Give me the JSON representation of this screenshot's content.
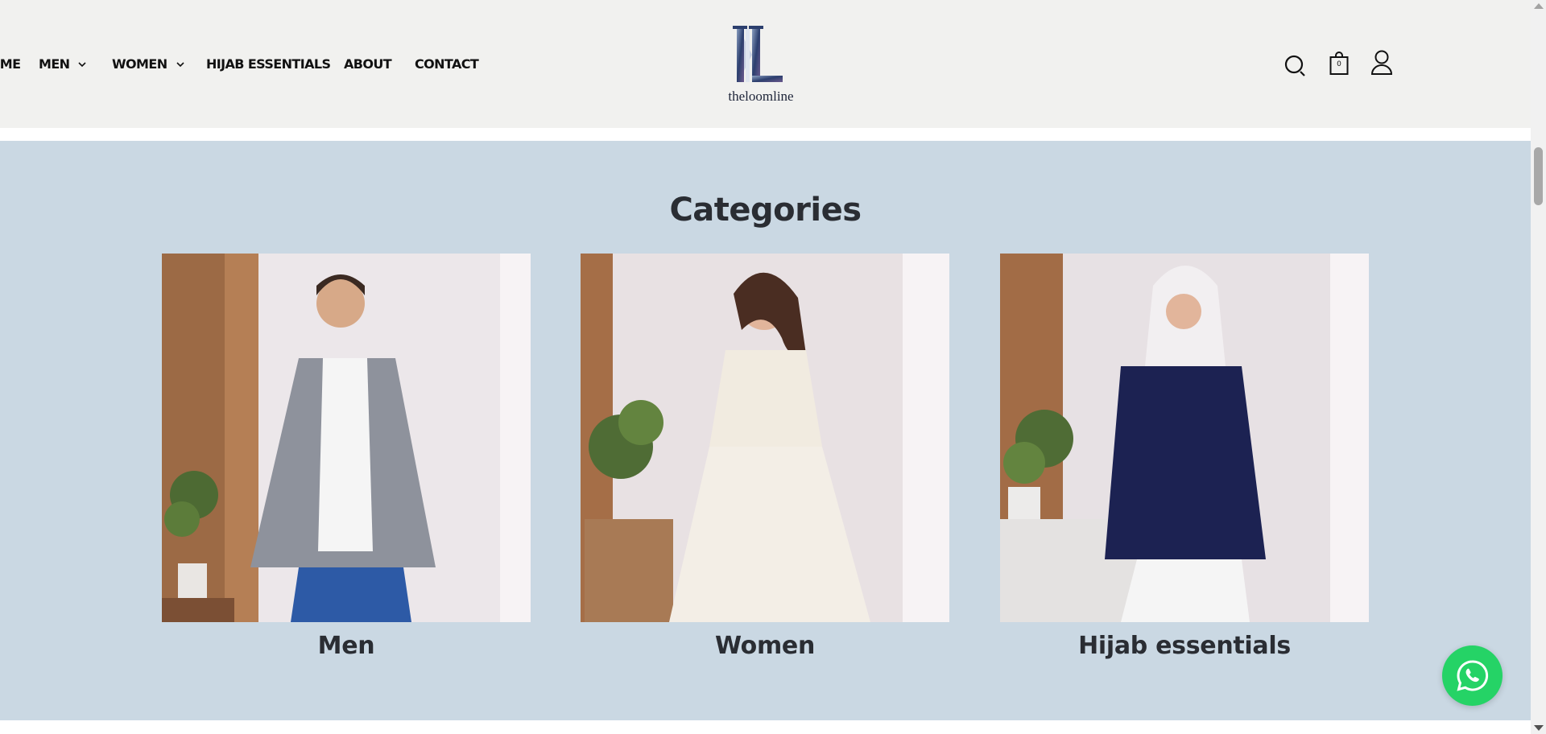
{
  "header": {
    "nav": [
      {
        "label": "HOME",
        "has_dropdown": false
      },
      {
        "label": "MEN",
        "has_dropdown": true
      },
      {
        "label": "WOMEN",
        "has_dropdown": true
      },
      {
        "label": "HIJAB ESSENTIALS",
        "has_dropdown": false
      },
      {
        "label": "ABOUT",
        "has_dropdown": false
      },
      {
        "label": "CONTACT",
        "has_dropdown": false
      }
    ],
    "logo": {
      "text": "theloomline",
      "mark": "LL monogram"
    },
    "icons": [
      "search-icon",
      "cart-icon",
      "account-icon"
    ],
    "cart_count": "0"
  },
  "categories": {
    "title": "Categories",
    "items": [
      {
        "label": "Men",
        "image": "man in grey shirt and jeans"
      },
      {
        "label": "Women",
        "image": "woman in white embroidered dress"
      },
      {
        "label": "Hijab essentials",
        "image": "woman in white hijab and navy tunic"
      }
    ]
  },
  "colors": {
    "header_bg": "#f1f1ef",
    "section_bg": "#cad8e3",
    "text_dark": "#2a2d33",
    "whatsapp": "#25d366"
  }
}
